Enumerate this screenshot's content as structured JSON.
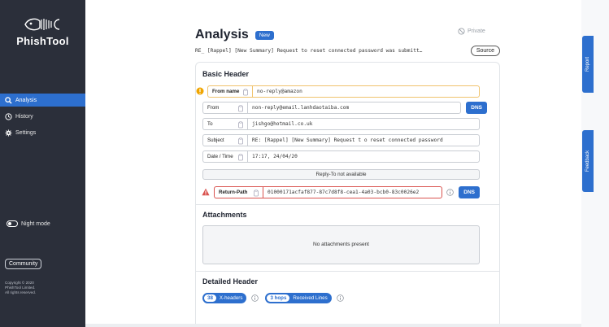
{
  "app": {
    "name": "PhishTool"
  },
  "sidebar": {
    "items": [
      {
        "label": "Analysis",
        "icon": "search-icon",
        "active": true
      },
      {
        "label": "History",
        "icon": "history-icon",
        "active": false
      },
      {
        "label": "Settings",
        "icon": "gear-icon",
        "active": false
      }
    ],
    "night_mode_label": "Night mode",
    "community_label": "Community",
    "copyright": [
      "Copyright © 2020",
      "PhishTool Limited.",
      "All rights reserved."
    ]
  },
  "header": {
    "title": "Analysis",
    "badge": "New",
    "private_label": "Private",
    "subject_preview": "RE_ [Rappel] [New Summary] Request to reset connected password was submitt…",
    "source_button": "Source"
  },
  "basic_header": {
    "title": "Basic Header",
    "fields": {
      "from_name": {
        "label": "From name",
        "value": "no-reply@amazon"
      },
      "from": {
        "label": "From",
        "value": "non-reply@email.lanhdaotaiba.com",
        "action": "DNS"
      },
      "to": {
        "label": "To",
        "value": "jishgo@hotmail.co.uk"
      },
      "subject": {
        "label": "Subject",
        "value": "RE: [Rappel] [New Summary] Request t o reset connected password"
      },
      "date_time": {
        "label": "Date / Time",
        "value": "17:17, 24/04/20"
      },
      "return_path": {
        "label": "Return-Path",
        "value": "01000171acfaf877-87c7d8f8-cea1-4a03-bcb0-83c0026e2",
        "action": "DNS"
      }
    },
    "reply_to_status": "Reply-To not available"
  },
  "attachments": {
    "title": "Attachments",
    "empty_text": "No attachments present"
  },
  "detailed_header": {
    "title": "Detailed Header",
    "x_headers": {
      "count": "38",
      "label": "X-headers"
    },
    "received": {
      "count": "3 hops",
      "label": "Received Lines"
    }
  },
  "side_tabs": {
    "report": "Report",
    "feedback": "Feedback"
  },
  "colors": {
    "sidebar_bg": "#2b2f3a",
    "accent": "#2d6fce",
    "warning": "#f0a500",
    "danger": "#d9534f"
  }
}
